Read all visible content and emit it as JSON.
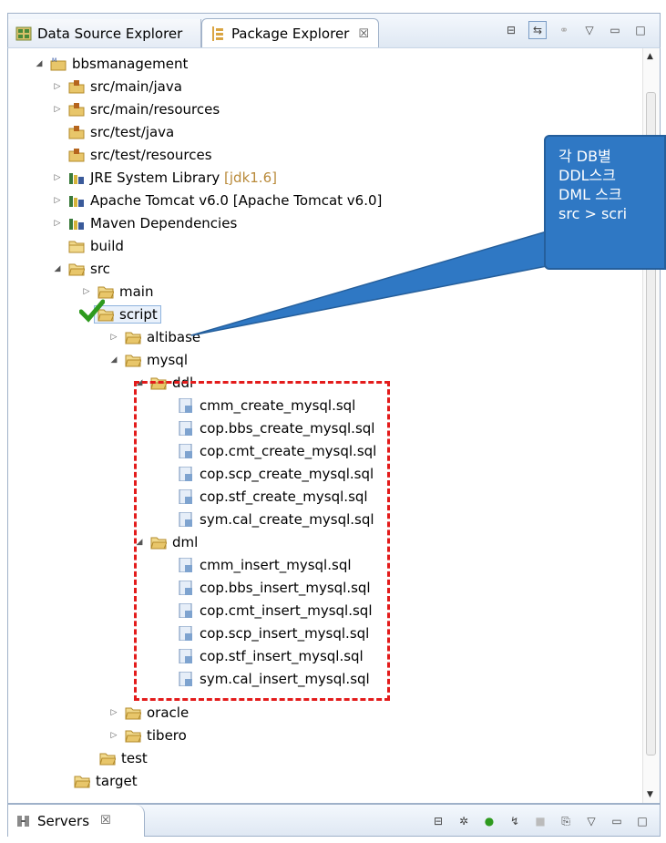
{
  "tabs": {
    "inactive": "Data Source Explorer",
    "active": "Package Explorer",
    "close": "☒"
  },
  "tree": {
    "project": "bbsmanagement",
    "items": [
      {
        "label": "src/main/java"
      },
      {
        "label": "src/main/resources"
      },
      {
        "label": "src/test/java"
      },
      {
        "label": "src/test/resources"
      },
      {
        "label": "JRE System Library",
        "suffix": "[jdk1.6]"
      },
      {
        "label": "Apache Tomcat v6.0 [Apache Tomcat v6.0]"
      },
      {
        "label": "Maven Dependencies"
      },
      {
        "label": "build"
      },
      {
        "label": "src"
      },
      {
        "label": "main"
      },
      {
        "label": "script"
      },
      {
        "label": "altibase"
      },
      {
        "label": "mysql"
      },
      {
        "label": "ddl"
      },
      {
        "label": "cmm_create_mysql.sql"
      },
      {
        "label": "cop.bbs_create_mysql.sql"
      },
      {
        "label": "cop.cmt_create_mysql.sql"
      },
      {
        "label": "cop.scp_create_mysql.sql"
      },
      {
        "label": "cop.stf_create_mysql.sql"
      },
      {
        "label": "sym.cal_create_mysql.sql"
      },
      {
        "label": "dml"
      },
      {
        "label": "cmm_insert_mysql.sql"
      },
      {
        "label": "cop.bbs_insert_mysql.sql"
      },
      {
        "label": "cop.cmt_insert_mysql.sql"
      },
      {
        "label": "cop.scp_insert_mysql.sql"
      },
      {
        "label": "cop.stf_insert_mysql.sql"
      },
      {
        "label": "sym.cal_insert_mysql.sql"
      },
      {
        "label": "oracle"
      },
      {
        "label": "tibero"
      },
      {
        "label": "test"
      },
      {
        "label": "target"
      }
    ]
  },
  "callout": {
    "lines": [
      "각 DB별",
      "DDL스크",
      "DML 스크",
      "src > scri"
    ]
  },
  "bottom": {
    "tab": "Servers",
    "close": "☒"
  },
  "colors": {
    "callout": "#2f78c4",
    "highlight": "#e31b1b",
    "folder": "#e8c66a"
  }
}
